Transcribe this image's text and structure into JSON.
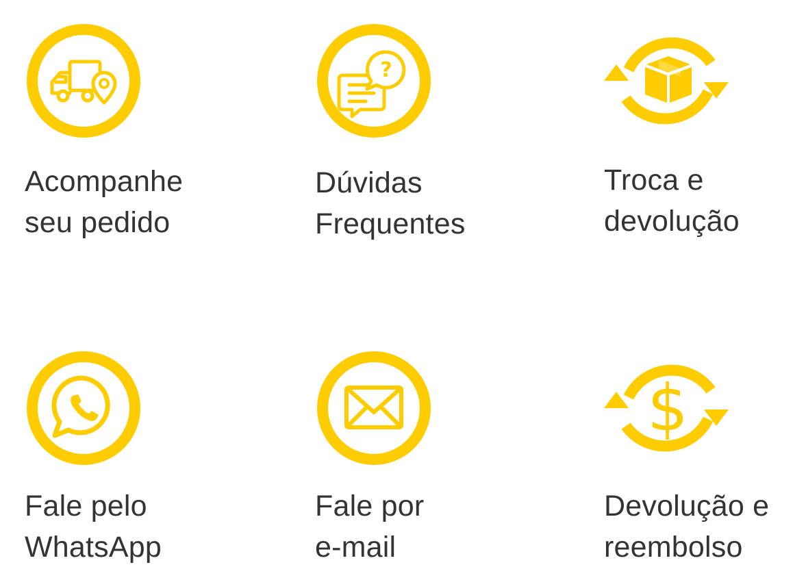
{
  "accent_color": "#FFCC00",
  "text_color": "#333333",
  "items": [
    {
      "icon": "truck-location-icon",
      "line1": "Acompanhe",
      "line2": "seu pedido"
    },
    {
      "icon": "faq-chat-icon",
      "line1": "Dúvidas",
      "line2": "Frequentes"
    },
    {
      "icon": "box-exchange-icon",
      "line1": "Troca e",
      "line2": "devolução"
    },
    {
      "icon": "whatsapp-icon",
      "line1": "Fale pelo",
      "line2": "WhatsApp"
    },
    {
      "icon": "mail-icon",
      "line1": "Fale por",
      "line2": "e-mail"
    },
    {
      "icon": "dollar-refund-icon",
      "line1": "Devolução e",
      "line2": "reembolso"
    }
  ]
}
